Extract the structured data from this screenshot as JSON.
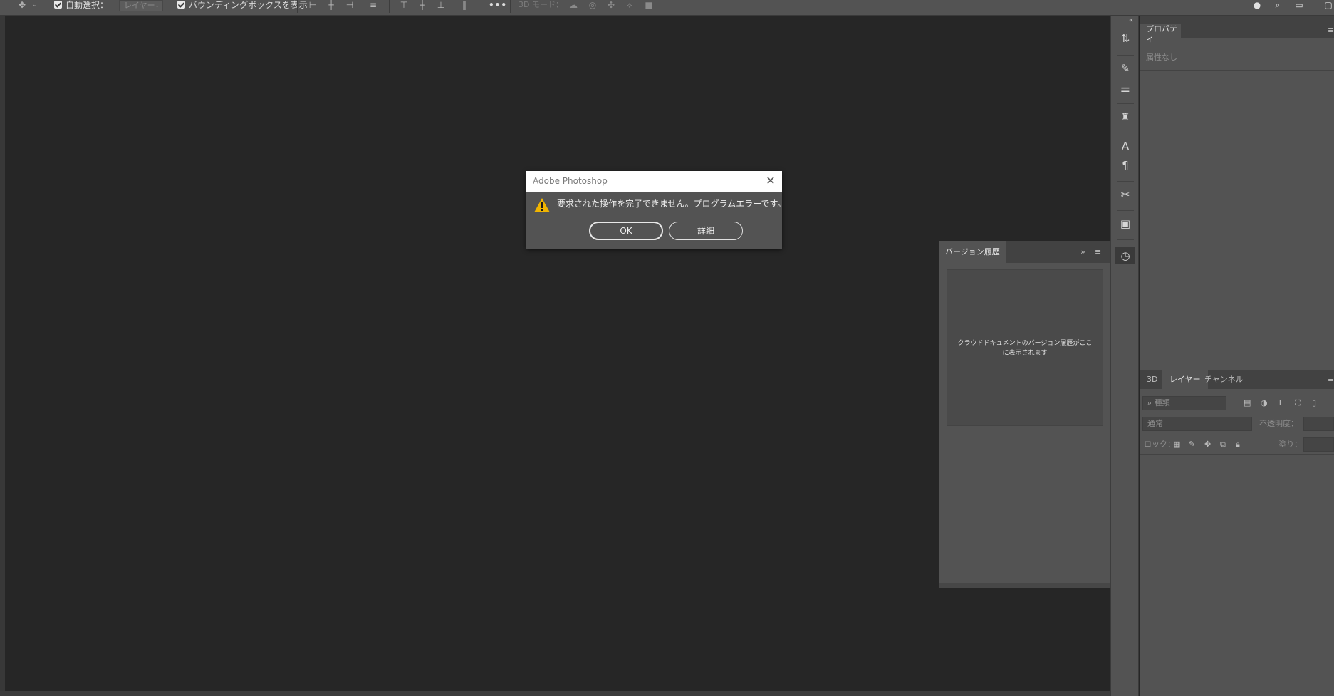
{
  "options_bar": {
    "auto_select_label": "自動選択：",
    "auto_select_target": "レイヤー",
    "bounding_box_label": "バウンディングボックスを表示",
    "more_label": "•••",
    "mode_3d_label": "3D モード："
  },
  "dialog": {
    "title": "Adobe Photoshop",
    "message": "要求された操作を完了できません。プログラムエラーです。",
    "ok_label": "OK",
    "details_label": "詳細"
  },
  "version_panel": {
    "tab_label": "バージョン履歴",
    "empty_text_line1": "クラウドドキュメントのバージョン履歴がここ",
    "empty_text_line2": "に表示されます"
  },
  "properties_panel": {
    "tab_label": "プロパティ",
    "empty_label": "属性なし"
  },
  "layers_panel": {
    "tabs": [
      "3D",
      "レイヤー",
      "チャンネル"
    ],
    "filter_placeholder": "種類",
    "blend_mode": "通常",
    "opacity_label": "不透明度：",
    "lock_label": "ロック：",
    "fill_label": "塗り："
  },
  "colors": {
    "ui_bg": "#535353",
    "canvas_bg": "#262626",
    "warning": "#f0b400"
  }
}
